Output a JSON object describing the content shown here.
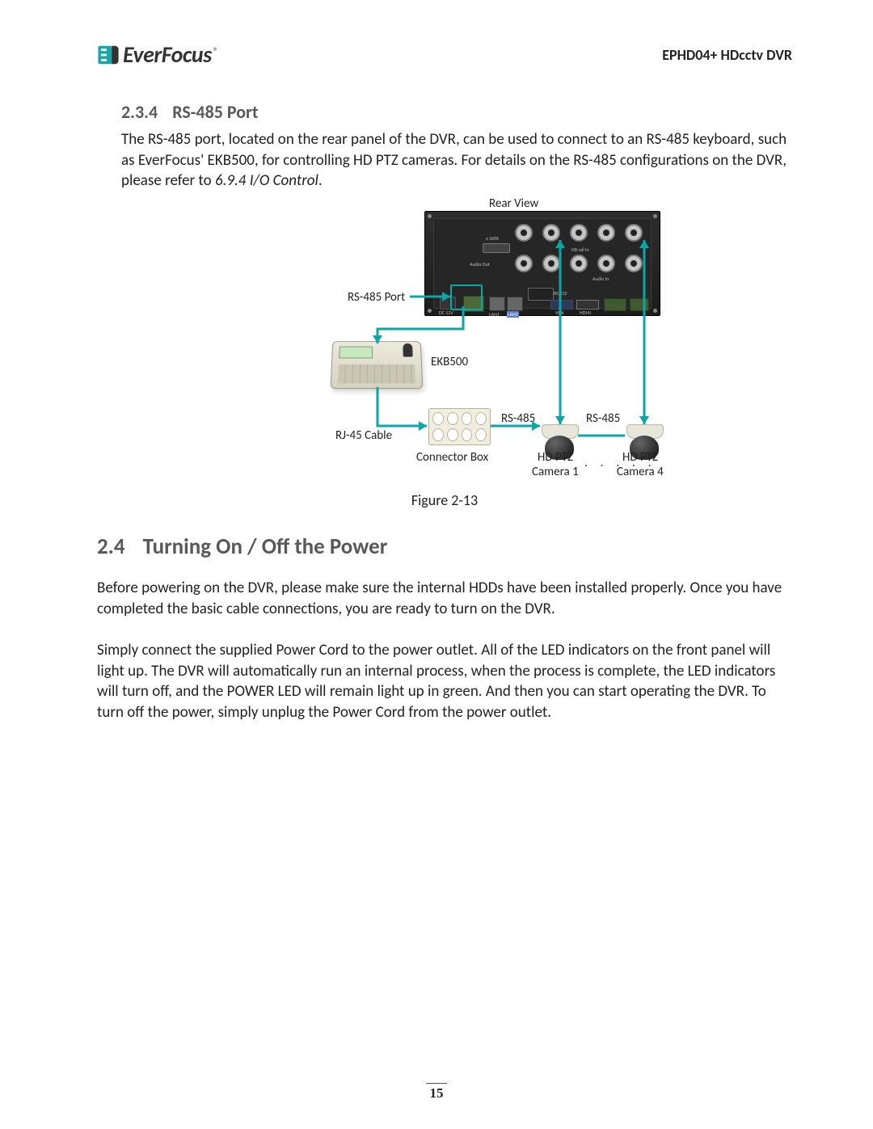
{
  "brand": {
    "name": "EverFocus",
    "registered": "®"
  },
  "product": "EPHD04+  HDcctv DVR",
  "section_234": {
    "number": "2.3.4",
    "title": "RS-485 Port",
    "text_a": "The RS-485 port, located on the rear panel of the DVR, can be used to connect to an RS-485 keyboard, such as EverFocus' EKB500, for controlling HD PTZ cameras. For details on the RS-485 configurations on the DVR, please refer to ",
    "text_ref": "6.9.4 I/O Control",
    "text_b": "."
  },
  "diagram": {
    "rear_view": "Rear View",
    "rs485_port": "RS-485 Port",
    "ekb500": "EKB500",
    "rj45": "RJ-45 Cable",
    "connector_box": "Connector Box",
    "rs485_a": "RS-485",
    "rs485_b": "RS-485",
    "cam1_a": "HD PTZ",
    "cam1_b": "Camera 1",
    "cam4_a": "HD PTZ",
    "cam4_b": "Camera 4",
    "dots": ". . . . .",
    "panel": {
      "esata": "e SATA",
      "audio_out": "Audio Out",
      "hdsdi_in": "HD sdi In",
      "audio_in": "Audio In",
      "rs232": "RS 232",
      "dc12v": "DC 12V",
      "lan1": "LAN1",
      "lan2": "LAN2",
      "vga": "VGA",
      "hdmi": "HDMI"
    }
  },
  "figure_caption": "Figure 2-13",
  "section_24": {
    "number": "2.4",
    "title": "Turning On / Off the Power",
    "para1": "Before powering on the DVR, please make sure the internal HDDs have been installed properly. Once you have completed the basic cable connections, you are ready to turn on the DVR.",
    "para2": "Simply connect the supplied Power Cord to the power outlet. All of the LED indicators on the front panel will light up. The DVR will automatically run an internal process, when the process is complete, the LED indicators will turn off, and the POWER LED will remain light up in green. And then you can start operating the DVR. To turn off the power, simply unplug the Power Cord from the power outlet."
  },
  "page_number": "15"
}
